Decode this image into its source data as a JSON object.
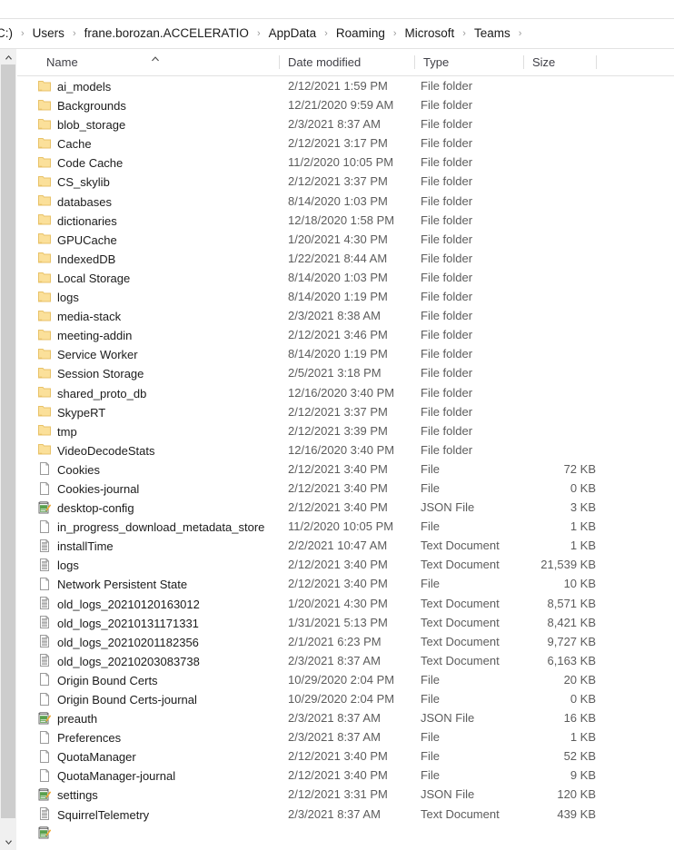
{
  "window": {
    "type": "file-explorer",
    "colors": {
      "folder_fill": "#fbe09a",
      "folder_edge": "#e8c268",
      "doc_fill": "#ffffff",
      "doc_edge": "#9a9a9a",
      "json_green": "#5aa04e",
      "json_pencil": "#f0a830",
      "text_primary": "#1b1b1b",
      "text_secondary": "#5c5c5c",
      "scrollbar_thumb": "#cdcdcd",
      "scrollbar_track": "#f0f0f0",
      "divider": "#e2e2e2"
    }
  },
  "breadcrumb": {
    "name": "address-bar",
    "separator": "›",
    "items": [
      "C:)",
      "Users",
      "frane.borozan.ACCELERATIO",
      "AppData",
      "Roaming",
      "Microsoft",
      "Teams"
    ],
    "trailing_separator": "›"
  },
  "columns": [
    {
      "key": "name",
      "label": "Name",
      "sorted": true,
      "sort_direction": "ascending"
    },
    {
      "key": "date",
      "label": "Date modified",
      "sorted": false
    },
    {
      "key": "type",
      "label": "Type",
      "sorted": false
    },
    {
      "key": "size",
      "label": "Size",
      "sorted": false
    }
  ],
  "rows": [
    {
      "icon": "folder-icon",
      "name": "ai_models",
      "date": "2/12/2021 1:59 PM",
      "type": "File folder",
      "size": ""
    },
    {
      "icon": "folder-icon",
      "name": "Backgrounds",
      "date": "12/21/2020 9:59 AM",
      "type": "File folder",
      "size": ""
    },
    {
      "icon": "folder-icon",
      "name": "blob_storage",
      "date": "2/3/2021 8:37 AM",
      "type": "File folder",
      "size": ""
    },
    {
      "icon": "folder-icon",
      "name": "Cache",
      "date": "2/12/2021 3:17 PM",
      "type": "File folder",
      "size": ""
    },
    {
      "icon": "folder-icon",
      "name": "Code Cache",
      "date": "11/2/2020 10:05 PM",
      "type": "File folder",
      "size": ""
    },
    {
      "icon": "folder-icon",
      "name": "CS_skylib",
      "date": "2/12/2021 3:37 PM",
      "type": "File folder",
      "size": ""
    },
    {
      "icon": "folder-icon",
      "name": "databases",
      "date": "8/14/2020 1:03 PM",
      "type": "File folder",
      "size": ""
    },
    {
      "icon": "folder-icon",
      "name": "dictionaries",
      "date": "12/18/2020 1:58 PM",
      "type": "File folder",
      "size": ""
    },
    {
      "icon": "folder-icon",
      "name": "GPUCache",
      "date": "1/20/2021 4:30 PM",
      "type": "File folder",
      "size": ""
    },
    {
      "icon": "folder-icon",
      "name": "IndexedDB",
      "date": "1/22/2021 8:44 AM",
      "type": "File folder",
      "size": ""
    },
    {
      "icon": "folder-icon",
      "name": "Local Storage",
      "date": "8/14/2020 1:03 PM",
      "type": "File folder",
      "size": ""
    },
    {
      "icon": "folder-icon",
      "name": "logs",
      "date": "8/14/2020 1:19 PM",
      "type": "File folder",
      "size": ""
    },
    {
      "icon": "folder-icon",
      "name": "media-stack",
      "date": "2/3/2021 8:38 AM",
      "type": "File folder",
      "size": ""
    },
    {
      "icon": "folder-icon",
      "name": "meeting-addin",
      "date": "2/12/2021 3:46 PM",
      "type": "File folder",
      "size": ""
    },
    {
      "icon": "folder-icon",
      "name": "Service Worker",
      "date": "8/14/2020 1:19 PM",
      "type": "File folder",
      "size": ""
    },
    {
      "icon": "folder-icon",
      "name": "Session Storage",
      "date": "2/5/2021 3:18 PM",
      "type": "File folder",
      "size": ""
    },
    {
      "icon": "folder-icon",
      "name": "shared_proto_db",
      "date": "12/16/2020 3:40 PM",
      "type": "File folder",
      "size": ""
    },
    {
      "icon": "folder-icon",
      "name": "SkypeRT",
      "date": "2/12/2021 3:37 PM",
      "type": "File folder",
      "size": ""
    },
    {
      "icon": "folder-icon",
      "name": "tmp",
      "date": "2/12/2021 3:39 PM",
      "type": "File folder",
      "size": ""
    },
    {
      "icon": "folder-icon",
      "name": "VideoDecodeStats",
      "date": "12/16/2020 3:40 PM",
      "type": "File folder",
      "size": ""
    },
    {
      "icon": "blank-file-icon",
      "name": "Cookies",
      "date": "2/12/2021 3:40 PM",
      "type": "File",
      "size": "72 KB"
    },
    {
      "icon": "blank-file-icon",
      "name": "Cookies-journal",
      "date": "2/12/2021 3:40 PM",
      "type": "File",
      "size": "0 KB"
    },
    {
      "icon": "json-file-icon",
      "name": "desktop-config",
      "date": "2/12/2021 3:40 PM",
      "type": "JSON File",
      "size": "3 KB"
    },
    {
      "icon": "blank-file-icon",
      "name": "in_progress_download_metadata_store",
      "date": "11/2/2020 10:05 PM",
      "type": "File",
      "size": "1 KB"
    },
    {
      "icon": "text-document-icon",
      "name": "installTime",
      "date": "2/2/2021 10:47 AM",
      "type": "Text Document",
      "size": "1 KB"
    },
    {
      "icon": "text-document-icon",
      "name": "logs",
      "date": "2/12/2021 3:40 PM",
      "type": "Text Document",
      "size": "21,539 KB"
    },
    {
      "icon": "blank-file-icon",
      "name": "Network Persistent State",
      "date": "2/12/2021 3:40 PM",
      "type": "File",
      "size": "10 KB"
    },
    {
      "icon": "text-document-icon",
      "name": "old_logs_20210120163012",
      "date": "1/20/2021 4:30 PM",
      "type": "Text Document",
      "size": "8,571 KB"
    },
    {
      "icon": "text-document-icon",
      "name": "old_logs_20210131171331",
      "date": "1/31/2021 5:13 PM",
      "type": "Text Document",
      "size": "8,421 KB"
    },
    {
      "icon": "text-document-icon",
      "name": "old_logs_20210201182356",
      "date": "2/1/2021 6:23 PM",
      "type": "Text Document",
      "size": "9,727 KB"
    },
    {
      "icon": "text-document-icon",
      "name": "old_logs_20210203083738",
      "date": "2/3/2021 8:37 AM",
      "type": "Text Document",
      "size": "6,163 KB"
    },
    {
      "icon": "blank-file-icon",
      "name": "Origin Bound Certs",
      "date": "10/29/2020 2:04 PM",
      "type": "File",
      "size": "20 KB"
    },
    {
      "icon": "blank-file-icon",
      "name": "Origin Bound Certs-journal",
      "date": "10/29/2020 2:04 PM",
      "type": "File",
      "size": "0 KB"
    },
    {
      "icon": "json-file-icon",
      "name": "preauth",
      "date": "2/3/2021 8:37 AM",
      "type": "JSON File",
      "size": "16 KB"
    },
    {
      "icon": "blank-file-icon",
      "name": "Preferences",
      "date": "2/3/2021 8:37 AM",
      "type": "File",
      "size": "1 KB"
    },
    {
      "icon": "blank-file-icon",
      "name": "QuotaManager",
      "date": "2/12/2021 3:40 PM",
      "type": "File",
      "size": "52 KB"
    },
    {
      "icon": "blank-file-icon",
      "name": "QuotaManager-journal",
      "date": "2/12/2021 3:40 PM",
      "type": "File",
      "size": "9 KB"
    },
    {
      "icon": "json-file-icon",
      "name": "settings",
      "date": "2/12/2021 3:31 PM",
      "type": "JSON File",
      "size": "120 KB"
    },
    {
      "icon": "text-document-icon",
      "name": "SquirrelTelemetry",
      "date": "2/3/2021 8:37 AM",
      "type": "Text Document",
      "size": "439 KB"
    },
    {
      "icon": "json-file-icon",
      "name": "",
      "date": "",
      "type": "",
      "size": "",
      "clipped": true
    }
  ],
  "scrollbar": {
    "name": "vertical-scrollbar",
    "position": "left",
    "up_arrow": "scroll-up-arrow",
    "down_arrow": "scroll-down-arrow"
  }
}
